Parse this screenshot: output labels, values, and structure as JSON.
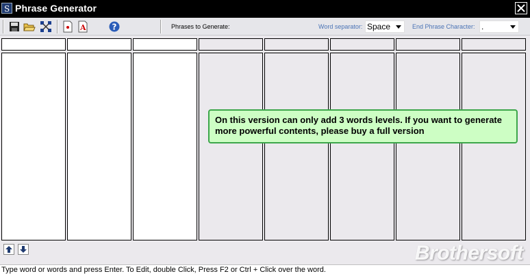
{
  "window": {
    "title": "Phrase Generator"
  },
  "toolbar": {
    "phrases_label": "Phrases to Generate:",
    "word_separator_label": "Word separator:",
    "word_separator_value": "Space",
    "end_phrase_label": "End Phrase Character:",
    "end_phrase_value": "."
  },
  "columns": {
    "count": 8,
    "enabled": 3
  },
  "notice": {
    "text": "On this version can only add 3 words levels. If you want to generate more powerful contents, please buy a full version"
  },
  "statusbar": {
    "text": "Type word or words and press Enter. To Edit, double Click, Press F2 or Ctrl + Click over the word."
  },
  "watermark": {
    "text": "Brothersoft"
  },
  "colors": {
    "notice_bg": "#cdfec4",
    "notice_border": "#3ca64a",
    "label_blue": "#4a73b5"
  }
}
